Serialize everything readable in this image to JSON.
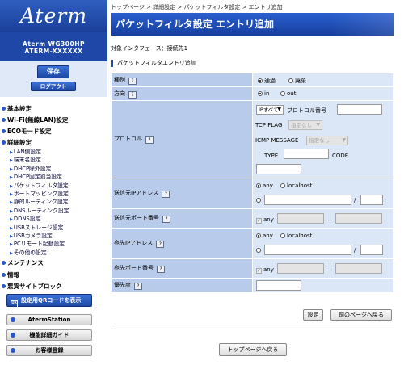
{
  "brand": {
    "logo": "Aterm",
    "model_line1": "Aterm WG300HP",
    "model_line2": "ATERM-XXXXXX"
  },
  "actions": {
    "save": "保存",
    "logout": "ログアウト"
  },
  "menu": {
    "basic": "基本設定",
    "wifi": "Wi-Fi(無線LAN)設定",
    "eco": "ECOモード設定",
    "detail": "詳細設定",
    "detail_items": [
      "LAN側設定",
      "端末名設定",
      "DHCP除外設定",
      "DHCP固定割当設定",
      "パケットフィルタ設定",
      "ポートマッピング設定",
      "静的ルーティング設定",
      "DNSルーティング設定",
      "DDNS設定",
      "USBストレージ設定",
      "USBカメラ設定",
      "PCリモート起動設定",
      "その他の設定"
    ],
    "maintenance": "メンテナンス",
    "info": "情報",
    "block": "悪質サイトブロック"
  },
  "side_buttons": {
    "qr": "設定用QRコードを表示",
    "qr_icon": "QR",
    "aterm_station": "AtermStation",
    "manual": "機能詳細ガイド",
    "support": "お客様登録"
  },
  "breadcrumb": "トップページ > 詳細設定 > パケットフィルタ設定 > エントリ追加",
  "page_title": "パケットフィルタ設定 エントリ追加",
  "interface_text": "対象インタフェース：接続先1",
  "section_title": "パケットフィルタエントリ追加",
  "help_glyph": "?",
  "form": {
    "type_label": "種別",
    "type_opt1": "通過",
    "type_opt2": "廃棄",
    "dir_label": "方向",
    "dir_opt1": "in",
    "dir_opt2": "out",
    "proto_label": "プロトコル",
    "proto_select": "IPすべて",
    "proto_num_label": "プロトコル番号",
    "tcpflag_label": "TCP FLAG",
    "tcpflag_select": "指定なし",
    "icmp_label": "ICMP MESSAGE",
    "icmp_select": "指定なし",
    "icmp_type": "TYPE",
    "icmp_code": "CODE",
    "src_ip_label": "送信元IPアドレス",
    "any": "any",
    "localhost": "localhost",
    "slash": "/",
    "src_port_label": "送信元ポート番号",
    "dash": "－",
    "dst_ip_label": "宛先IPアドレス",
    "dst_port_label": "宛先ポート番号",
    "priority_label": "優先度"
  },
  "buttons": {
    "set": "設定",
    "back": "前のページへ戻る",
    "top": "トップページへ戻る"
  },
  "colors": {
    "accent": "#1c48a6",
    "label_bg": "#b9cbea",
    "value_bg": "#dbe6f6"
  }
}
